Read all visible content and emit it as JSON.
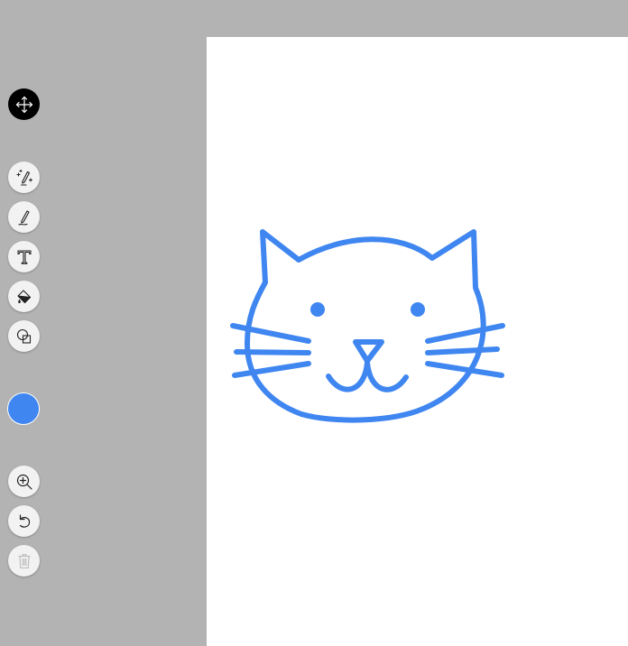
{
  "toolbar": {
    "tools": [
      {
        "name": "move-tool",
        "icon": "move-arrows-icon",
        "active": true
      },
      {
        "name": "magic-pen-tool",
        "icon": "magic-pen-icon"
      },
      {
        "name": "pen-tool",
        "icon": "pen-icon"
      },
      {
        "name": "text-tool",
        "icon": "text-icon"
      },
      {
        "name": "fill-tool",
        "icon": "paint-bucket-icon"
      },
      {
        "name": "shapes-tool",
        "icon": "shapes-icon"
      },
      {
        "name": "zoom-tool",
        "icon": "zoom-in-icon"
      },
      {
        "name": "undo-tool",
        "icon": "undo-icon"
      },
      {
        "name": "delete-tool",
        "icon": "trash-icon",
        "disabled": true
      }
    ],
    "current_color": "#3f86f0"
  },
  "canvas": {
    "background": "#ffffff",
    "drawing": {
      "subject": "cat-face",
      "stroke_color": "#3f86f0"
    }
  }
}
